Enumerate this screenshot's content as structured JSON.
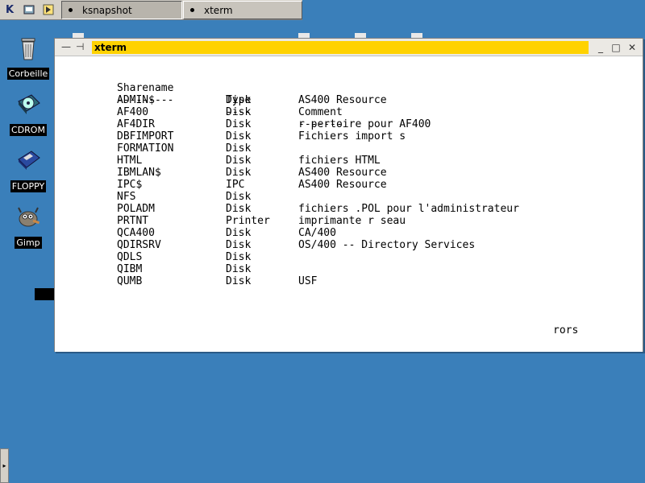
{
  "taskbar": {
    "start_label": "K",
    "tasks": [
      {
        "label": "ksnapshot",
        "active": true
      },
      {
        "label": "xterm",
        "active": false
      }
    ]
  },
  "desktop": {
    "icons": [
      {
        "label": "Corbeille",
        "icon": "trash-icon"
      },
      {
        "label": "CDROM",
        "icon": "cdrom-icon"
      },
      {
        "label": "FLOPPY",
        "icon": "floppy-icon"
      },
      {
        "label": "Gimp",
        "icon": "gimp-icon"
      }
    ]
  },
  "window": {
    "title": "xterm",
    "controls": {
      "minimize": "—",
      "pin": "⊣",
      "iconify": "_",
      "maximize": "□",
      "close": "✕"
    }
  },
  "terminal": {
    "headers": [
      "Sharename",
      "Type",
      "Comment"
    ],
    "separators": [
      "---------",
      "----",
      "-------"
    ],
    "rows": [
      [
        "ADMIN$",
        "Disk",
        "AS400 Resource"
      ],
      [
        "AF400",
        "Disk",
        ""
      ],
      [
        "AF4DIR",
        "Disk",
        "r pertoire pour AF400"
      ],
      [
        "DBFIMPORT",
        "Disk",
        "Fichiers import s"
      ],
      [
        "FORMATION",
        "Disk",
        ""
      ],
      [
        "HTML",
        "Disk",
        "fichiers HTML"
      ],
      [
        "IBMLAN$",
        "Disk",
        "AS400 Resource"
      ],
      [
        "IPC$",
        "IPC",
        "AS400 Resource"
      ],
      [
        "NFS",
        "Disk",
        ""
      ],
      [
        "POLADM",
        "Disk",
        "fichiers .POL pour l'administrateur"
      ],
      [
        "PRTNT",
        "Printer",
        "imprimante r seau"
      ],
      [
        "QCA400",
        "Disk",
        "CA/400"
      ],
      [
        "QDIRSRV",
        "Disk",
        "OS/400 -- Directory Services"
      ],
      [
        "QDLS",
        "Disk",
        ""
      ],
      [
        "QIBM",
        "Disk",
        ""
      ],
      [
        "QUMB",
        "Disk",
        "USF"
      ]
    ],
    "trailing_fragment": "rors"
  }
}
